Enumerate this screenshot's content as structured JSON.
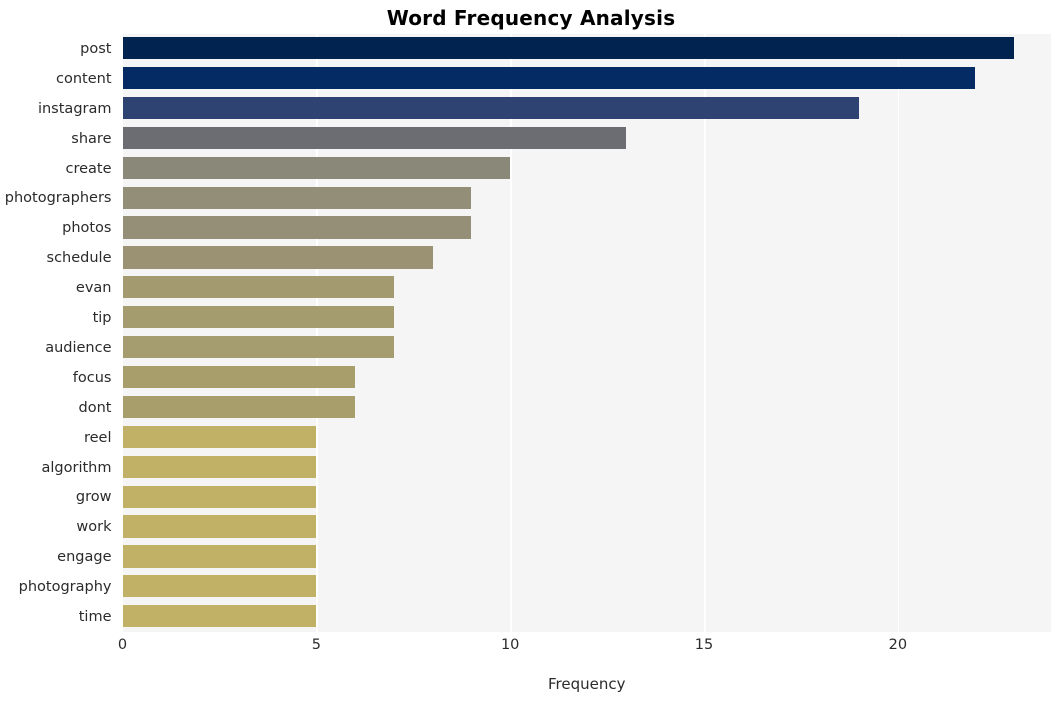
{
  "chart_data": {
    "type": "bar",
    "orientation": "horizontal",
    "title": "Word Frequency Analysis",
    "xlabel": "Frequency",
    "ylabel": "",
    "categories": [
      "post",
      "content",
      "instagram",
      "share",
      "create",
      "photographers",
      "photos",
      "schedule",
      "evan",
      "tip",
      "audience",
      "focus",
      "dont",
      "reel",
      "algorithm",
      "grow",
      "work",
      "engage",
      "photography",
      "time"
    ],
    "values": [
      23,
      22,
      19,
      13,
      10,
      9,
      9,
      8,
      7,
      7,
      7,
      6,
      6,
      5,
      5,
      5,
      5,
      5,
      5,
      5
    ],
    "bar_colors": [
      "#00234f",
      "#042b63",
      "#2e4372",
      "#6b6d72",
      "#8a8878",
      "#938e77",
      "#948f76",
      "#9a9273",
      "#a39a70",
      "#a49b6f",
      "#a59c6f",
      "#a89e6c",
      "#a89e6c",
      "#c0b167",
      "#c0b167",
      "#c0b167",
      "#c0b167",
      "#c0b167",
      "#c0b167",
      "#c0b167"
    ],
    "xticks": [
      0,
      5,
      10,
      15,
      20
    ],
    "xlim": [
      0,
      23.95
    ],
    "grid": true,
    "gridlines_at": [
      5,
      10,
      15,
      20
    ],
    "legend": null,
    "plot_background": "#f5f5f6",
    "figure_background": "#ffffff"
  }
}
